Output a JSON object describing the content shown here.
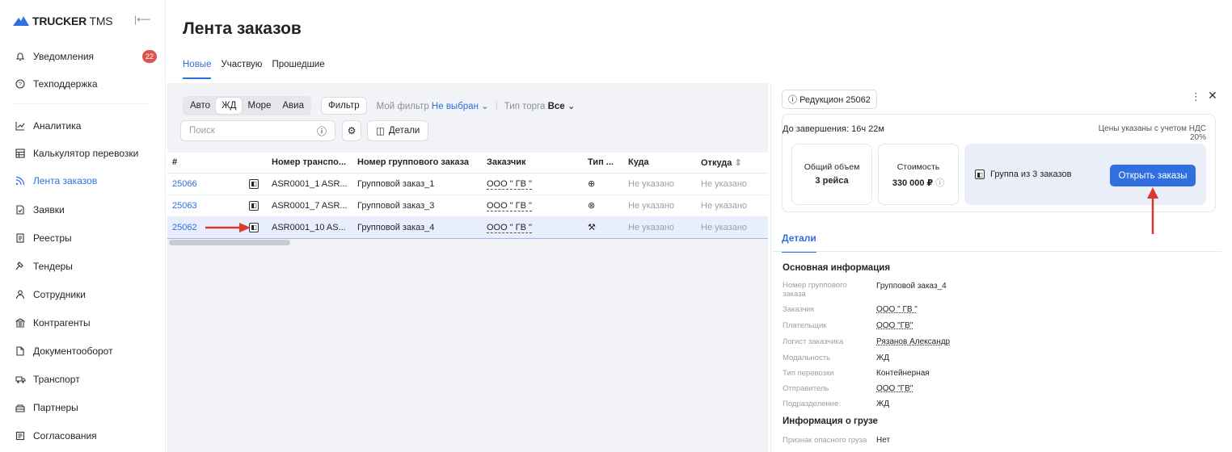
{
  "app": {
    "logo_bold": "TRUCKER",
    "logo_light": " TMS",
    "collapse_icon": "collapse-left-icon"
  },
  "notifications_count": "22",
  "sidebar": {
    "items": [
      {
        "label": "Уведомления",
        "icon": "bell-icon"
      },
      {
        "label": "Техподдержка",
        "icon": "help-circle-icon"
      },
      {
        "label": "Аналитика",
        "icon": "chart-line-icon"
      },
      {
        "label": "Калькулятор перевозки",
        "icon": "calculator-icon"
      },
      {
        "label": "Лента заказов",
        "icon": "feed-icon"
      },
      {
        "label": "Заявки",
        "icon": "document-check-icon"
      },
      {
        "label": "Реестры",
        "icon": "registry-icon"
      },
      {
        "label": "Тендеры",
        "icon": "gavel-icon"
      },
      {
        "label": "Сотрудники",
        "icon": "user-icon"
      },
      {
        "label": "Контрагенты",
        "icon": "bank-icon"
      },
      {
        "label": "Документооборот",
        "icon": "file-icon"
      },
      {
        "label": "Транспорт",
        "icon": "truck-icon"
      },
      {
        "label": "Партнеры",
        "icon": "handshake-icon"
      },
      {
        "label": "Согласования",
        "icon": "approval-icon"
      }
    ]
  },
  "main": {
    "title": "Лента заказов",
    "tabs": [
      "Новые",
      "Участвую",
      "Прошедшие"
    ],
    "modes": [
      "Авто",
      "ЖД",
      "Море",
      "Авиа"
    ],
    "filter_label": "Фильтр",
    "my_filter_label": "Мой фильтр",
    "my_filter_value": "Не выбран",
    "trade_label": "Тип торга",
    "trade_value": "Все",
    "search_placeholder": "Поиск",
    "details_label": "Детали"
  },
  "table": {
    "headers": [
      "#",
      "Номер транспо...",
      "Номер группового заказа",
      "Заказчик",
      "Тип ...",
      "Куда",
      "Откуда"
    ],
    "rows": [
      {
        "id": "25066",
        "transport": "ASR0001_1 ASR...",
        "group": "Групповой заказ_1",
        "customer": "ООО \" ГВ \"",
        "type_icon": "crosshair-icon",
        "to": "Не указано",
        "from": "Не указано"
      },
      {
        "id": "25063",
        "transport": "ASR0001_7 ASR...",
        "group": "Групповой заказ_3",
        "customer": "ООО \" ГВ \"",
        "type_icon": "search-plus-icon",
        "to": "Не указано",
        "from": "Не указано"
      },
      {
        "id": "25062",
        "transport": "ASR0001_10 AS...",
        "group": "Групповой заказ_4",
        "customer": "ООО \" ГВ \"",
        "type_icon": "gavel-icon",
        "to": "Не указано",
        "from": "Не указано"
      }
    ]
  },
  "detail": {
    "badge": "Редукцион 25062",
    "deadline": "До завершения: 16ч 22м",
    "vat_note": "Цены указаны с учетом НДС 20%",
    "volume_label": "Общий объем",
    "volume_value": "3 рейса",
    "cost_label": "Стоимость",
    "cost_value": "330 000 ₽",
    "group_label": "Группа из 3 заказов",
    "open_button": "Открыть заказы",
    "tab": "Детали",
    "section_main": "Основная информация",
    "fields": [
      {
        "label": "Номер группового заказа",
        "value": "Групповой заказ_4"
      },
      {
        "label": "Заказчик",
        "value": "ООО \" ГВ \""
      },
      {
        "label": "Плательщик",
        "value": "ООО \"ГВ\""
      },
      {
        "label": "Логист заказчика",
        "value": "Рязанов Александр"
      },
      {
        "label": "Модальность",
        "value": "ЖД"
      },
      {
        "label": "Тип перевозки",
        "value": "Контейнерная"
      },
      {
        "label": "Отправитель",
        "value": "ООО \"ГВ\""
      },
      {
        "label": "Подразделение",
        "value": "ЖД"
      }
    ],
    "section_cargo": "Информация о грузе",
    "cargo_fields": [
      {
        "label": "Признак опасного груза",
        "value": "Нет"
      }
    ]
  },
  "colors": {
    "accent": "#2f6fe0",
    "badge": "#d9534f",
    "annotation_arrow": "#d93a2b"
  }
}
